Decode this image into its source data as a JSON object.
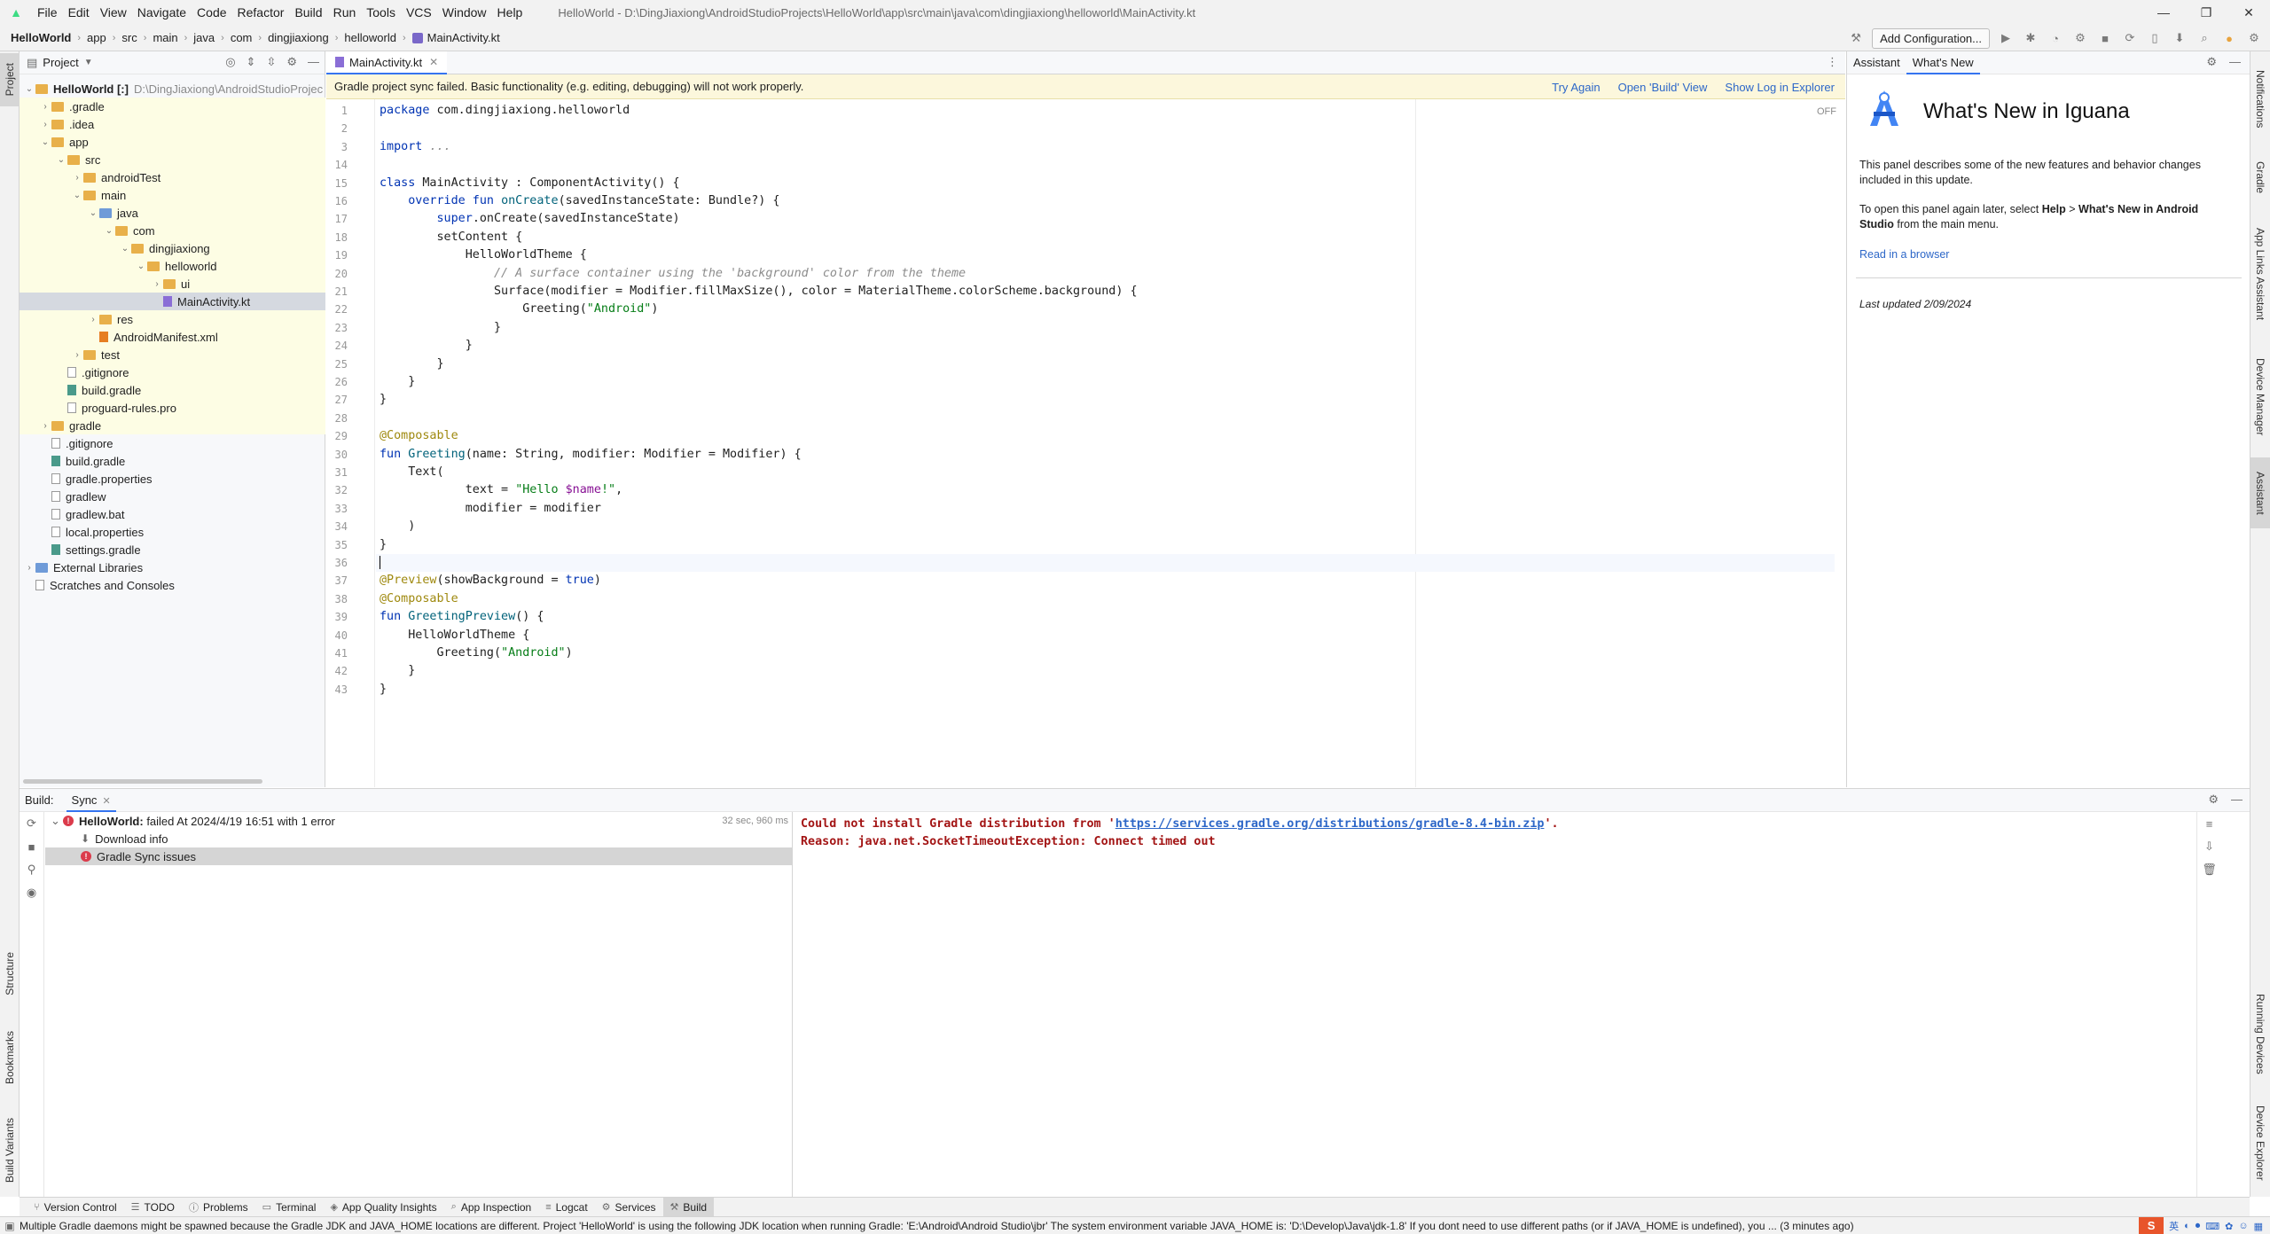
{
  "window": {
    "title": "HelloWorld - D:\\DingJiaxiong\\AndroidStudioProjects\\HelloWorld\\app\\src\\main\\java\\com\\dingjiaxiong\\helloworld\\MainActivity.kt",
    "menu": [
      "File",
      "Edit",
      "View",
      "Navigate",
      "Code",
      "Refactor",
      "Build",
      "Run",
      "Tools",
      "VCS",
      "Window",
      "Help"
    ],
    "controls": {
      "minimize": "—",
      "restore": "❐",
      "close": "✕"
    }
  },
  "breadcrumbs": [
    "HelloWorld",
    "app",
    "src",
    "main",
    "java",
    "com",
    "dingjiaxiong",
    "helloworld",
    "MainActivity.kt"
  ],
  "toolbar": {
    "add_configuration": "Add Configuration..."
  },
  "left_stripe": {
    "project": "Project",
    "structure": "Structure",
    "bookmarks": "Bookmarks",
    "build_variants": "Build Variants"
  },
  "right_stripe": {
    "notifications": "Notifications",
    "gradle": "Gradle",
    "app_links": "App Links Assistant",
    "device_manager": "Device Manager",
    "assistant": "Assistant",
    "running_devices": "Running Devices",
    "device_explorer": "Device Explorer"
  },
  "project_panel": {
    "title": "Project",
    "tree": [
      {
        "label": "HelloWorld [:]",
        "hint": "D:\\DingJiaxiong\\AndroidStudioProjec",
        "depth": 0,
        "open": true,
        "kind": "module"
      },
      {
        "label": ".gradle",
        "depth": 1,
        "open": false,
        "kind": "folder"
      },
      {
        "label": ".idea",
        "depth": 1,
        "open": false,
        "kind": "folder"
      },
      {
        "label": "app",
        "depth": 1,
        "open": true,
        "kind": "folder"
      },
      {
        "label": "src",
        "depth": 2,
        "open": true,
        "kind": "folder"
      },
      {
        "label": "androidTest",
        "depth": 3,
        "open": false,
        "kind": "folder"
      },
      {
        "label": "main",
        "depth": 3,
        "open": true,
        "kind": "folder"
      },
      {
        "label": "java",
        "depth": 4,
        "open": true,
        "kind": "folder-blue"
      },
      {
        "label": "com",
        "depth": 5,
        "open": true,
        "kind": "folder"
      },
      {
        "label": "dingjiaxiong",
        "depth": 6,
        "open": true,
        "kind": "folder"
      },
      {
        "label": "helloworld",
        "depth": 7,
        "open": true,
        "kind": "folder"
      },
      {
        "label": "ui",
        "depth": 8,
        "open": false,
        "kind": "folder"
      },
      {
        "label": "MainActivity.kt",
        "depth": 8,
        "kind": "kt",
        "selected": true
      },
      {
        "label": "res",
        "depth": 4,
        "open": false,
        "kind": "folder"
      },
      {
        "label": "AndroidManifest.xml",
        "depth": 4,
        "kind": "xml"
      },
      {
        "label": "test",
        "depth": 3,
        "open": false,
        "kind": "folder"
      },
      {
        "label": ".gitignore",
        "depth": 2,
        "kind": "file"
      },
      {
        "label": "build.gradle",
        "depth": 2,
        "kind": "gradle"
      },
      {
        "label": "proguard-rules.pro",
        "depth": 2,
        "kind": "file"
      },
      {
        "label": "gradle",
        "depth": 1,
        "open": false,
        "kind": "folder"
      },
      {
        "label": ".gitignore",
        "depth": 1,
        "kind": "file"
      },
      {
        "label": "build.gradle",
        "depth": 1,
        "kind": "gradle"
      },
      {
        "label": "gradle.properties",
        "depth": 1,
        "kind": "file"
      },
      {
        "label": "gradlew",
        "depth": 1,
        "kind": "file"
      },
      {
        "label": "gradlew.bat",
        "depth": 1,
        "kind": "file"
      },
      {
        "label": "local.properties",
        "depth": 1,
        "kind": "file"
      },
      {
        "label": "settings.gradle",
        "depth": 1,
        "kind": "gradle"
      },
      {
        "label": "External Libraries",
        "depth": 0,
        "open": false,
        "kind": "lib"
      },
      {
        "label": "Scratches and Consoles",
        "depth": 0,
        "kind": "scratch"
      }
    ]
  },
  "editor": {
    "tab": "MainActivity.kt",
    "inspection": "OFF",
    "banner": {
      "message": "Gradle project sync failed. Basic functionality (e.g. editing, debugging) will not work properly.",
      "links": [
        "Try Again",
        "Open 'Build' View",
        "Show Log in Explorer"
      ]
    },
    "lines": [
      {
        "n": "1",
        "html": "<span class='kw'>package</span> com.dingjiaxiong.helloworld"
      },
      {
        "n": "2",
        "html": ""
      },
      {
        "n": "3",
        "html": "<span class='kw'>import</span> <span class='cm'>...</span>"
      },
      {
        "n": "14",
        "html": ""
      },
      {
        "n": "15",
        "html": "<span class='kw'>class</span> MainActivity : ComponentActivity() {"
      },
      {
        "n": "16",
        "html": "    <span class='kw'>override fun</span> <span class='fn'>onCreate</span>(savedInstanceState: Bundle?) {"
      },
      {
        "n": "17",
        "html": "        <span class='kw'>super</span>.onCreate(savedInstanceState)"
      },
      {
        "n": "18",
        "html": "        setContent {"
      },
      {
        "n": "19",
        "html": "            HelloWorldTheme {"
      },
      {
        "n": "20",
        "html": "                <span class='cm'>// A surface container using the 'background' color from the theme</span>"
      },
      {
        "n": "21",
        "html": "                Surface(modifier = Modifier.fillMaxSize(), color = MaterialTheme.colorScheme.background) {"
      },
      {
        "n": "22",
        "html": "                    Greeting(<span class='st'>\"Android\"</span>)"
      },
      {
        "n": "23",
        "html": "                }"
      },
      {
        "n": "24",
        "html": "            }"
      },
      {
        "n": "25",
        "html": "        }"
      },
      {
        "n": "26",
        "html": "    }"
      },
      {
        "n": "27",
        "html": "}"
      },
      {
        "n": "28",
        "html": ""
      },
      {
        "n": "29",
        "html": "<span class='an'>@Composable</span>"
      },
      {
        "n": "30",
        "html": "<span class='kw'>fun</span> <span class='fn'>Greeting</span>(name: String, modifier: Modifier = Modifier) {"
      },
      {
        "n": "31",
        "html": "    Text("
      },
      {
        "n": "32",
        "html": "            text = <span class='st'>\"Hello </span><span class='pu'>$name</span><span class='st'>!\"</span>,"
      },
      {
        "n": "33",
        "html": "            modifier = modifier"
      },
      {
        "n": "34",
        "html": "    )"
      },
      {
        "n": "35",
        "html": "}"
      },
      {
        "n": "36",
        "html": "",
        "current": true
      },
      {
        "n": "37",
        "html": "<span class='an'>@Preview</span>(showBackground = <span class='kw'>true</span>)"
      },
      {
        "n": "38",
        "html": "<span class='an'>@Composable</span>"
      },
      {
        "n": "39",
        "html": "<span class='kw'>fun</span> <span class='fn'>GreetingPreview</span>() {"
      },
      {
        "n": "40",
        "html": "    HelloWorldTheme {"
      },
      {
        "n": "41",
        "html": "        Greeting(<span class='st'>\"Android\"</span>)"
      },
      {
        "n": "42",
        "html": "    }"
      },
      {
        "n": "43",
        "html": "}"
      }
    ]
  },
  "assistant": {
    "tabs": [
      "Assistant",
      "What's New"
    ],
    "title": "What's New in Iguana",
    "p1": "This panel describes some of the new features and behavior changes included in this update.",
    "p2_prefix": "To open this panel again later, select ",
    "p2_help": "Help",
    "p2_sep": " > ",
    "p2_whatsnew": "What's New in Android Studio",
    "p2_suffix": " from the main menu.",
    "link": "Read in a browser",
    "updated": "Last updated 2/09/2024"
  },
  "build": {
    "label": "Build:",
    "tab": "Sync",
    "tree": [
      {
        "bold": "HelloWorld:",
        "text": " failed At 2024/4/19 16:51 with 1 error",
        "time": "32 sec, 960 ms",
        "kind": "error",
        "depth": 0
      },
      {
        "text": "Download info",
        "kind": "download",
        "depth": 1
      },
      {
        "text": "Gradle Sync issues",
        "kind": "error",
        "depth": 1,
        "selected": true
      }
    ],
    "console": {
      "line1_prefix": "Could not install Gradle distribution from '",
      "line1_link": "https://services.gradle.org/distributions/gradle-8.4-bin.zip",
      "line1_suffix": "'.",
      "line2": "Reason: java.net.SocketTimeoutException: Connect timed out"
    }
  },
  "bottom_tools": [
    {
      "label": "Version Control",
      "icon": "⑂"
    },
    {
      "label": "TODO",
      "icon": "☰"
    },
    {
      "label": "Problems",
      "icon": "ⓘ"
    },
    {
      "label": "Terminal",
      "icon": "▭"
    },
    {
      "label": "App Quality Insights",
      "icon": "◈"
    },
    {
      "label": "App Inspection",
      "icon": "⌕"
    },
    {
      "label": "Logcat",
      "icon": "≡"
    },
    {
      "label": "Services",
      "icon": "⚙"
    },
    {
      "label": "Build",
      "icon": "⚒",
      "active": true
    }
  ],
  "status": {
    "message": "Multiple Gradle daemons might be spawned because the Gradle JDK and JAVA_HOME locations are different. Project 'HelloWorld' is using the following JDK location when running Gradle: 'E:\\Android\\Android Studio\\jbr' The system environment variable JAVA_HOME is: 'D:\\Develop\\Java\\jdk-1.8' If you dont need to use different paths (or if JAVA_HOME is undefined), you ... (3 minutes ago)",
    "ime": "S",
    "ime_lang": "英"
  },
  "colors": {
    "accent": "#3574f0",
    "error": "#db3b4b",
    "banner": "#fcf7dc",
    "highlight": "#fdfde4"
  }
}
